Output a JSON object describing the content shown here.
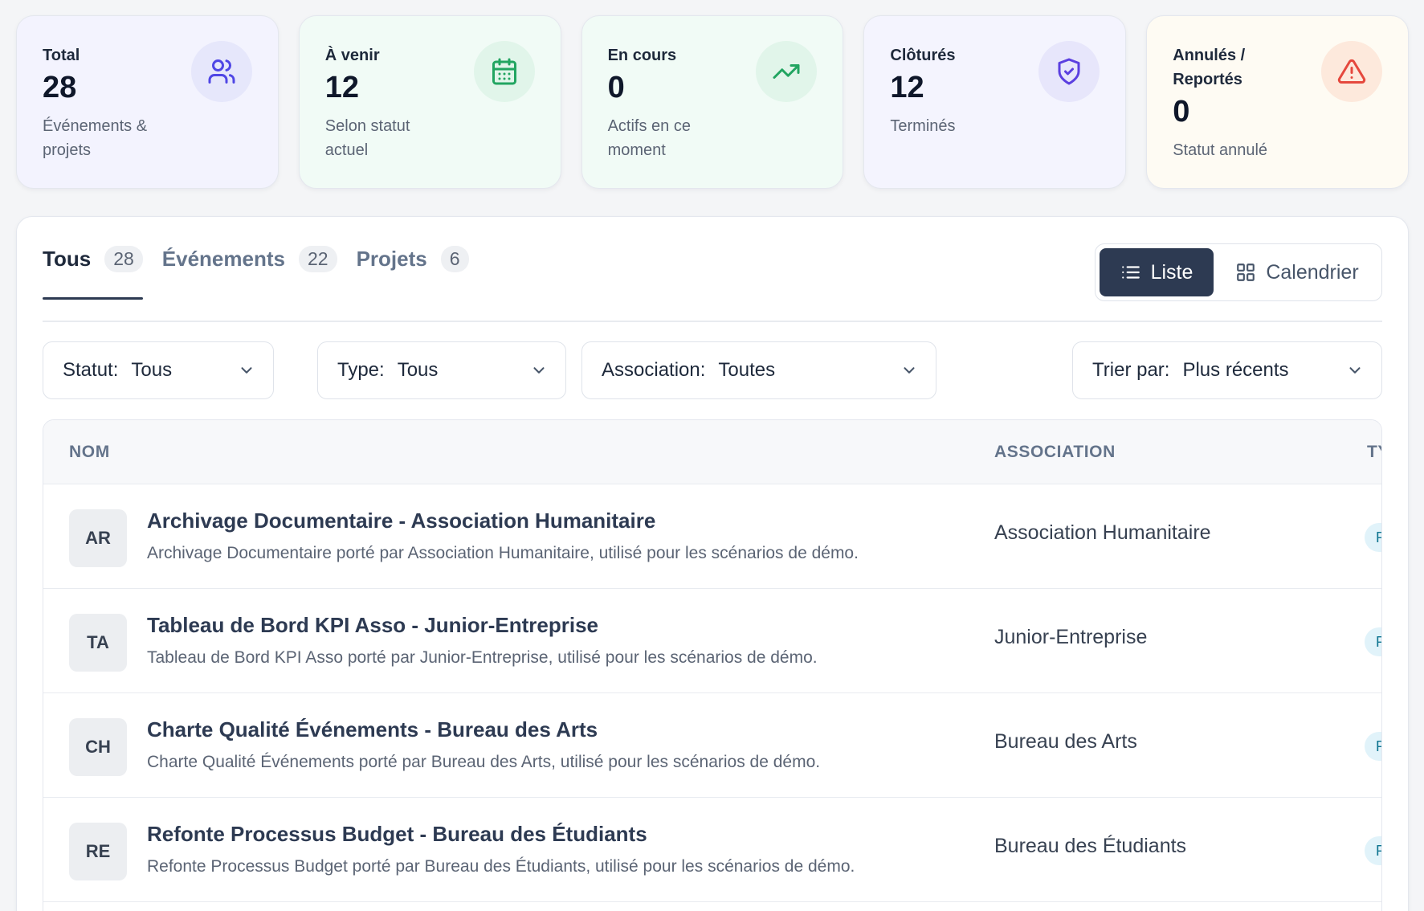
{
  "stats": [
    {
      "label": "Total",
      "value": "28",
      "sub": "Événements & projets",
      "icon": "users-icon"
    },
    {
      "label": "À venir",
      "value": "12",
      "sub": "Selon statut actuel",
      "icon": "calendar-icon"
    },
    {
      "label": "En cours",
      "value": "0",
      "sub": "Actifs en ce moment",
      "icon": "trending-up-icon"
    },
    {
      "label": "Clôturés",
      "value": "12",
      "sub": "Terminés",
      "icon": "shield-check-icon"
    },
    {
      "label": "Annulés / Reportés",
      "value": "0",
      "sub": "Statut annulé",
      "icon": "warning-icon"
    }
  ],
  "tabs": [
    {
      "label": "Tous",
      "count": "28"
    },
    {
      "label": "Événements",
      "count": "22"
    },
    {
      "label": "Projets",
      "count": "6"
    }
  ],
  "view": {
    "list_label": "Liste",
    "calendar_label": "Calendrier"
  },
  "filters": {
    "status": {
      "key": "Statut:",
      "value": "Tous"
    },
    "type": {
      "key": "Type:",
      "value": "Tous"
    },
    "association": {
      "key": "Association:",
      "value": "Toutes"
    },
    "sort": {
      "key": "Trier par:",
      "value": "Plus récents"
    }
  },
  "table": {
    "columns": {
      "name": "NOM",
      "association": "ASSOCIATION",
      "type": "TY"
    },
    "rows": [
      {
        "initials": "AR",
        "title": "Archivage Documentaire - Association Humanitaire",
        "description": "Archivage Documentaire porté par Association Humanitaire, utilisé pour les scénarios de démo.",
        "association": "Association Humanitaire",
        "type": "P"
      },
      {
        "initials": "TA",
        "title": "Tableau de Bord KPI Asso - Junior-Entreprise",
        "description": "Tableau de Bord KPI Asso porté par Junior-Entreprise, utilisé pour les scénarios de démo.",
        "association": "Junior-Entreprise",
        "type": "P"
      },
      {
        "initials": "CH",
        "title": "Charte Qualité Événements - Bureau des Arts",
        "description": "Charte Qualité Événements porté par Bureau des Arts, utilisé pour les scénarios de démo.",
        "association": "Bureau des Arts",
        "type": "P"
      },
      {
        "initials": "RE",
        "title": "Refonte Processus Budget - Bureau des Étudiants",
        "description": "Refonte Processus Budget porté par Bureau des Étudiants, utilisé pour les scénarios de démo.",
        "association": "Bureau des Étudiants",
        "type": "P"
      }
    ]
  }
}
